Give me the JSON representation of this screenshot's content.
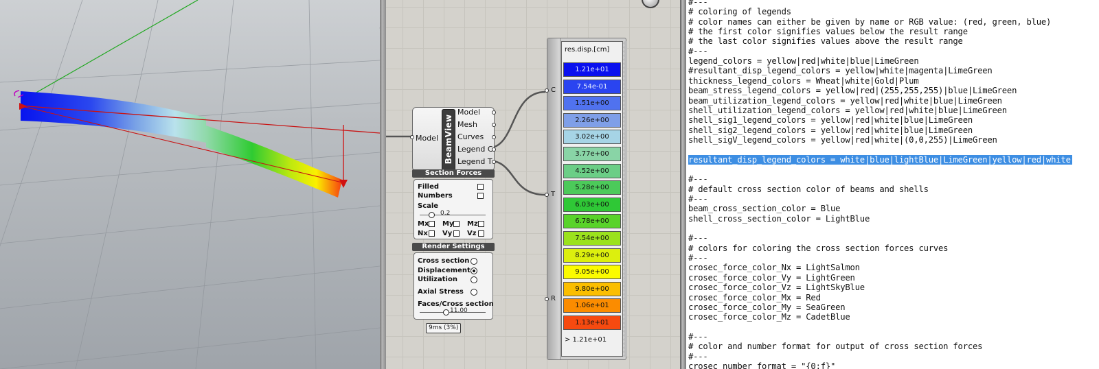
{
  "legend": {
    "title": "res.disp.[cm]",
    "inputs": [
      "C",
      "T",
      "R"
    ],
    "rows": [
      {
        "label": "1.21e+01",
        "color": "#0a10ee"
      },
      {
        "label": "7.54e-01",
        "color": "#2a44f0"
      },
      {
        "label": "1.51e+00",
        "color": "#5072ef"
      },
      {
        "label": "2.26e+00",
        "color": "#7f9fe8"
      },
      {
        "label": "3.02e+00",
        "color": "#a6d4e6"
      },
      {
        "label": "3.77e+00",
        "color": "#89d4a6"
      },
      {
        "label": "4.52e+00",
        "color": "#6bce86"
      },
      {
        "label": "5.28e+00",
        "color": "#4cca5a"
      },
      {
        "label": "6.03e+00",
        "color": "#2fc836"
      },
      {
        "label": "6.78e+00",
        "color": "#59d32a"
      },
      {
        "label": "7.54e+00",
        "color": "#9be21d"
      },
      {
        "label": "8.29e+00",
        "color": "#dcef0e"
      },
      {
        "label": "9.05e+00",
        "color": "#fbfb00"
      },
      {
        "label": "9.80e+00",
        "color": "#fbbe00"
      },
      {
        "label": "1.06e+01",
        "color": "#fb8c00"
      },
      {
        "label": "1.13e+01",
        "color": "#f64a10"
      }
    ],
    "last_label": "> 1.21e+01"
  },
  "beamview": {
    "title": "BeamView",
    "input_label": "Model",
    "outputs": [
      "Model",
      "Mesh",
      "Curves",
      "Legend C",
      "Legend T"
    ],
    "section_forces": {
      "header": "Section Forces",
      "filled_label": "Filled",
      "numbers_label": "Numbers",
      "scale_label": "Scale",
      "scale_value": "0.2",
      "scale_fraction": 0.18,
      "force_labels": [
        "Mx",
        "My",
        "Mz",
        "Nx",
        "Vy",
        "Vz"
      ]
    },
    "render_settings": {
      "header": "Render Settings",
      "options": [
        {
          "label": "Cross section",
          "selected": false
        },
        {
          "label": "Displacement",
          "selected": true
        },
        {
          "label": "Utilization",
          "selected": false
        },
        {
          "label": "Axial Stress",
          "selected": false
        }
      ],
      "faces_label": "Faces/Cross section",
      "faces_value": "11.00",
      "faces_fraction": 0.4
    },
    "timing": "9ms (3%)"
  },
  "editor": {
    "lines": [
      {
        "text": "#---",
        "selected": false
      },
      {
        "text": "# coloring of legends",
        "selected": false
      },
      {
        "text": "# color names can either be given by name or RGB value: (red, green, blue)",
        "selected": false
      },
      {
        "text": "# the first color signifies values below the result range",
        "selected": false
      },
      {
        "text": "# the last color signifies values above the result range",
        "selected": false
      },
      {
        "text": "#---",
        "selected": false
      },
      {
        "text": "legend_colors = yellow|red|white|blue|LimeGreen",
        "selected": false
      },
      {
        "text": "#resultant_disp_legend_colors = yellow|white|magenta|LimeGreen",
        "selected": false
      },
      {
        "text": "thickness_legend_colors = Wheat|white|Gold|Plum",
        "selected": false
      },
      {
        "text": "beam_stress_legend_colors = yellow|red|(255,255,255)|blue|LimeGreen",
        "selected": false
      },
      {
        "text": "beam_utilization_legend_colors = yellow|red|white|blue|LimeGreen",
        "selected": false
      },
      {
        "text": "shell_utilization_legend_colors = yellow|red|white|blue|LimeGreen",
        "selected": false
      },
      {
        "text": "shell_sig1_legend_colors = yellow|red|white|blue|LimeGreen",
        "selected": false
      },
      {
        "text": "shell_sig2_legend_colors = yellow|red|white|blue|LimeGreen",
        "selected": false
      },
      {
        "text": "shell_sigV_legend_colors = yellow|red|white|(0,0,255)|LimeGreen",
        "selected": false
      },
      {
        "text": "",
        "selected": false
      },
      {
        "text": "resultant_disp_legend_colors = white|blue|lightBlue|LimeGreen|yellow|red|white",
        "selected": true
      },
      {
        "text": "",
        "selected": false
      },
      {
        "text": "#---",
        "selected": false
      },
      {
        "text": "# default cross section color of beams and shells",
        "selected": false
      },
      {
        "text": "#---",
        "selected": false
      },
      {
        "text": "beam_cross_section_color = Blue",
        "selected": false
      },
      {
        "text": "shell_cross_section_color = LightBlue",
        "selected": false
      },
      {
        "text": "",
        "selected": false
      },
      {
        "text": "#---",
        "selected": false
      },
      {
        "text": "# colors for coloring the cross section forces curves",
        "selected": false
      },
      {
        "text": "#---",
        "selected": false
      },
      {
        "text": "crosec_force_color_Nx = LightSalmon",
        "selected": false
      },
      {
        "text": "crosec_force_color_Vy = LightGreen",
        "selected": false
      },
      {
        "text": "crosec_force_color_Vz = LightSkyBlue",
        "selected": false
      },
      {
        "text": "crosec_force_color_Mx = Red",
        "selected": false
      },
      {
        "text": "crosec_force_color_My = SeaGreen",
        "selected": false
      },
      {
        "text": "crosec_force_color_Mz = CadetBlue",
        "selected": false
      },
      {
        "text": "",
        "selected": false
      },
      {
        "text": "#---",
        "selected": false
      },
      {
        "text": "# color and number format for output of cross section forces",
        "selected": false
      },
      {
        "text": "#---",
        "selected": false
      },
      {
        "text": "crosec_number_format = \"{0:f}\"",
        "selected": false
      }
    ]
  }
}
